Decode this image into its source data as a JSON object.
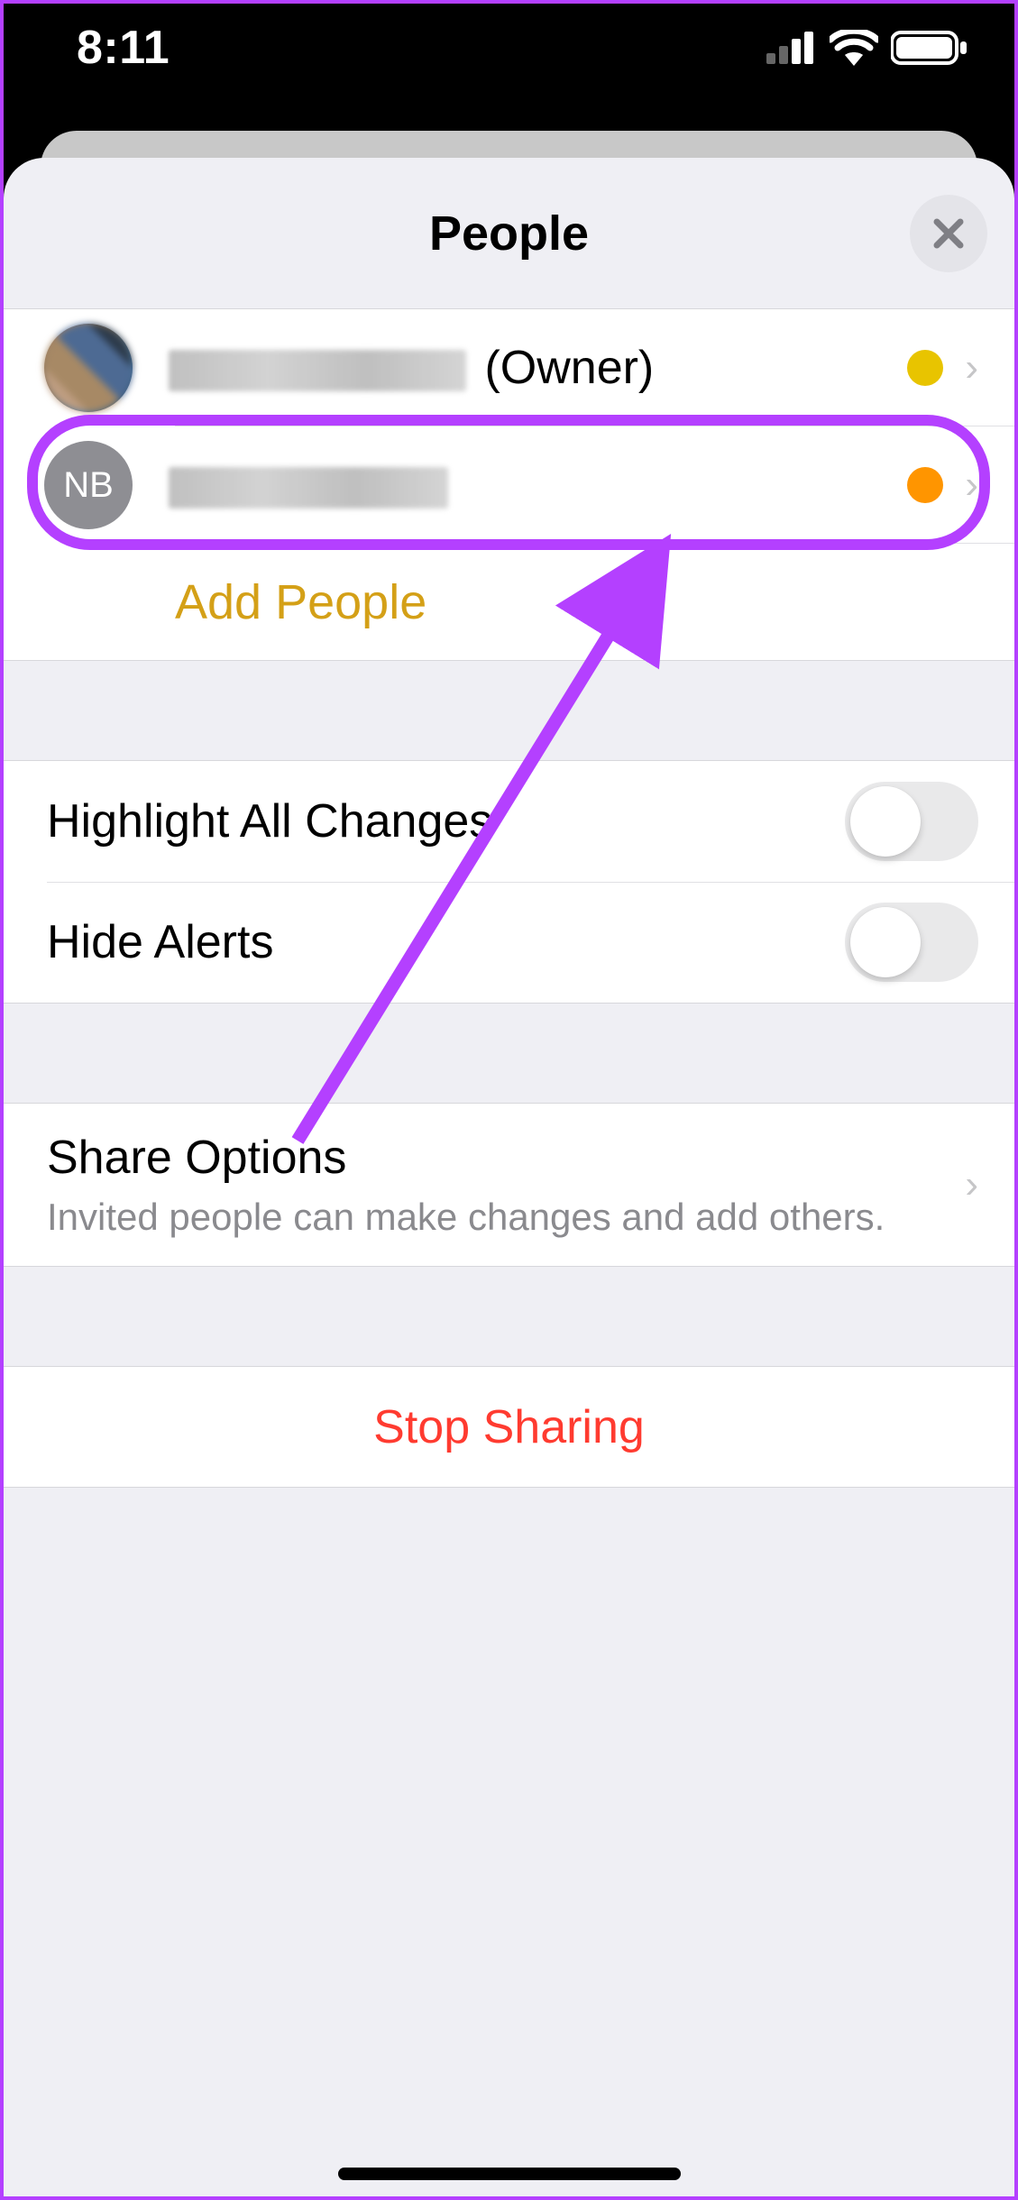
{
  "status_bar": {
    "time": "8:11"
  },
  "sheet": {
    "title": "People",
    "people": [
      {
        "role_suffix": "(Owner)",
        "dot": "yellow",
        "avatar_type": "photo"
      },
      {
        "initials": "NB",
        "dot": "orange",
        "avatar_type": "initials"
      }
    ],
    "add_people_label": "Add People"
  },
  "settings": {
    "highlight_label": "Highlight All Changes",
    "highlight_on": false,
    "hide_alerts_label": "Hide Alerts",
    "hide_alerts_on": false
  },
  "share_options": {
    "title": "Share Options",
    "subtitle": "Invited people can make changes and add others."
  },
  "stop_sharing_label": "Stop Sharing"
}
